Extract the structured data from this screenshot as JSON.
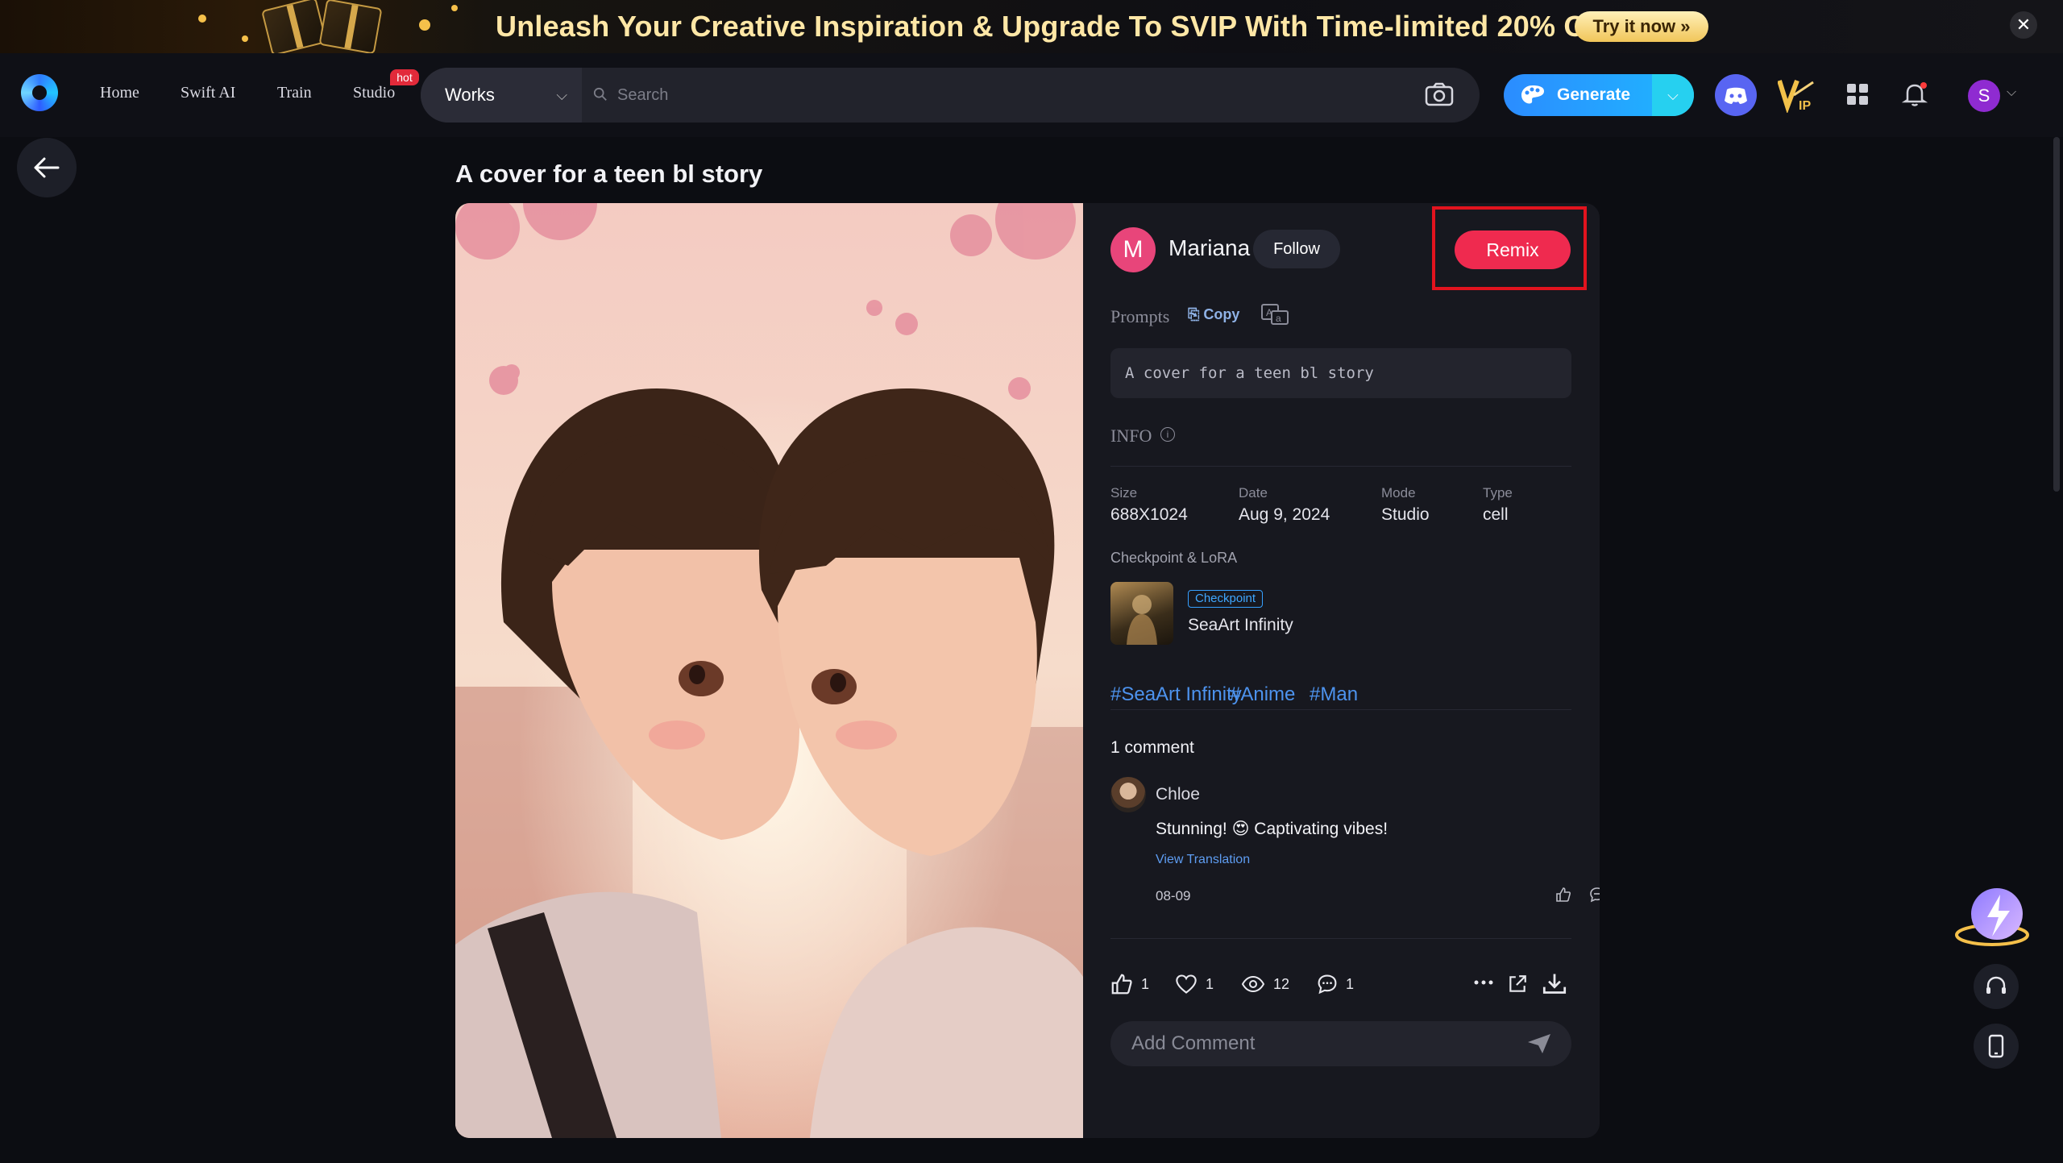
{
  "banner": {
    "text": "Unleash Your Creative Inspiration & Upgrade To SVIP With Time-limited 20% Off",
    "cta": "Try it now »",
    "close": "✕"
  },
  "nav": {
    "links": [
      "Home",
      "Swift AI",
      "Train",
      "Studio"
    ],
    "hot_badge": "hot",
    "search_scope": "Works",
    "search_placeholder": "Search",
    "generate_label": "Generate",
    "avatar_letter": "S"
  },
  "page": {
    "title": "A cover for a teen bl story"
  },
  "author": {
    "initial": "M",
    "name": "Mariana Mu...",
    "follow_label": "Follow",
    "remix_label": "Remix"
  },
  "prompts": {
    "label": "Prompts",
    "copy_label": "Copy",
    "text": "A cover for a teen bl story"
  },
  "info": {
    "label": "INFO",
    "fields": [
      {
        "key": "Size",
        "value": "688X1024"
      },
      {
        "key": "Date",
        "value": "Aug 9, 2024"
      },
      {
        "key": "Mode",
        "value": "Studio"
      },
      {
        "key": "Type",
        "value": "cell"
      }
    ],
    "checkpoint_label": "Checkpoint & LoRA",
    "checkpoint_badge": "Checkpoint",
    "checkpoint_name": "SeaArt Infinity"
  },
  "tags": [
    "#SeaArt Infinity",
    "#Anime",
    "#Man"
  ],
  "comments": {
    "count_label": "1 comment",
    "items": [
      {
        "author": "Chloe",
        "text": "Stunning! 😍 Captivating vibes!",
        "translate": "View Translation",
        "date": "08-09"
      }
    ],
    "input_placeholder": "Add Comment"
  },
  "stats": {
    "likes": "1",
    "favorites": "1",
    "views": "12",
    "comments": "1"
  },
  "colors": {
    "accent": "#ef2a4f",
    "link": "#4d93ee",
    "generate": "#2b8cff",
    "highlight_box": "#e2131e"
  }
}
